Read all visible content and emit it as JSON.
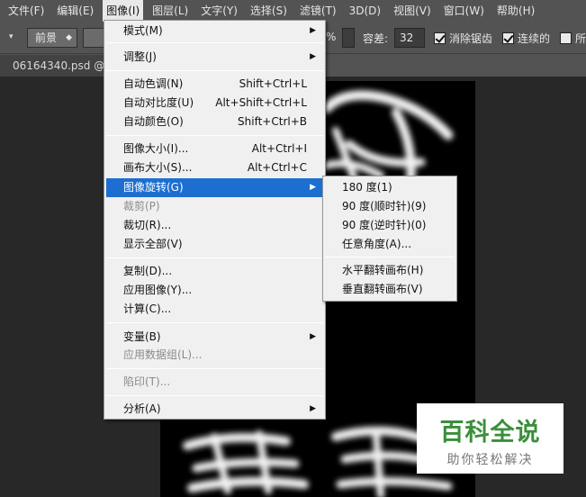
{
  "menubar": [
    {
      "label": "文件(F)"
    },
    {
      "label": "编辑(E)"
    },
    {
      "label": "图像(I)"
    },
    {
      "label": "图层(L)"
    },
    {
      "label": "文字(Y)"
    },
    {
      "label": "选择(S)"
    },
    {
      "label": "滤镜(T)"
    },
    {
      "label": "3D(D)"
    },
    {
      "label": "视图(V)"
    },
    {
      "label": "窗口(W)"
    },
    {
      "label": "帮助(H)"
    }
  ],
  "options": {
    "fill_source": "前景",
    "opacity_unit": "%",
    "tolerance_label": "容差:",
    "tolerance_value": "32",
    "antialias_label": "消除锯齿",
    "contiguous_label": "连续的",
    "all_layers_label": "所"
  },
  "document_tab": "06164340.psd @ 6",
  "image_menu": {
    "items": [
      {
        "label": "模式(M)",
        "shortcut": "",
        "submenu": true
      },
      {
        "label": "调整(J)",
        "shortcut": "",
        "submenu": true
      },
      {
        "label": "自动色调(N)",
        "shortcut": "Shift+Ctrl+L"
      },
      {
        "label": "自动对比度(U)",
        "shortcut": "Alt+Shift+Ctrl+L"
      },
      {
        "label": "自动颜色(O)",
        "shortcut": "Shift+Ctrl+B"
      },
      {
        "label": "图像大小(I)...",
        "shortcut": "Alt+Ctrl+I"
      },
      {
        "label": "画布大小(S)...",
        "shortcut": "Alt+Ctrl+C"
      },
      {
        "label": "图像旋转(G)",
        "shortcut": "",
        "submenu": true,
        "highlighted": true
      },
      {
        "label": "裁剪(P)",
        "shortcut": "",
        "disabled": true
      },
      {
        "label": "裁切(R)...",
        "shortcut": ""
      },
      {
        "label": "显示全部(V)",
        "shortcut": ""
      },
      {
        "label": "复制(D)...",
        "shortcut": ""
      },
      {
        "label": "应用图像(Y)...",
        "shortcut": ""
      },
      {
        "label": "计算(C)...",
        "shortcut": ""
      },
      {
        "label": "变量(B)",
        "shortcut": "",
        "submenu": true
      },
      {
        "label": "应用数据组(L)...",
        "shortcut": "",
        "disabled": true
      },
      {
        "label": "陷印(T)...",
        "shortcut": "",
        "disabled": true
      },
      {
        "label": "分析(A)",
        "shortcut": "",
        "submenu": true
      }
    ]
  },
  "rotate_submenu": {
    "items": [
      {
        "label": "180 度(1)"
      },
      {
        "label": "90 度(顺时针)(9)"
      },
      {
        "label": "90 度(逆时针)(0)"
      },
      {
        "label": "任意角度(A)..."
      },
      {
        "label": "水平翻转画布(H)"
      },
      {
        "label": "垂直翻转画布(V)"
      }
    ]
  },
  "watermark": {
    "title": "百科全说",
    "subtitle": "助你轻松解决"
  },
  "colors": {
    "menu_highlight": "#1c6fd1",
    "watermark_green": "#3a8f3a"
  }
}
